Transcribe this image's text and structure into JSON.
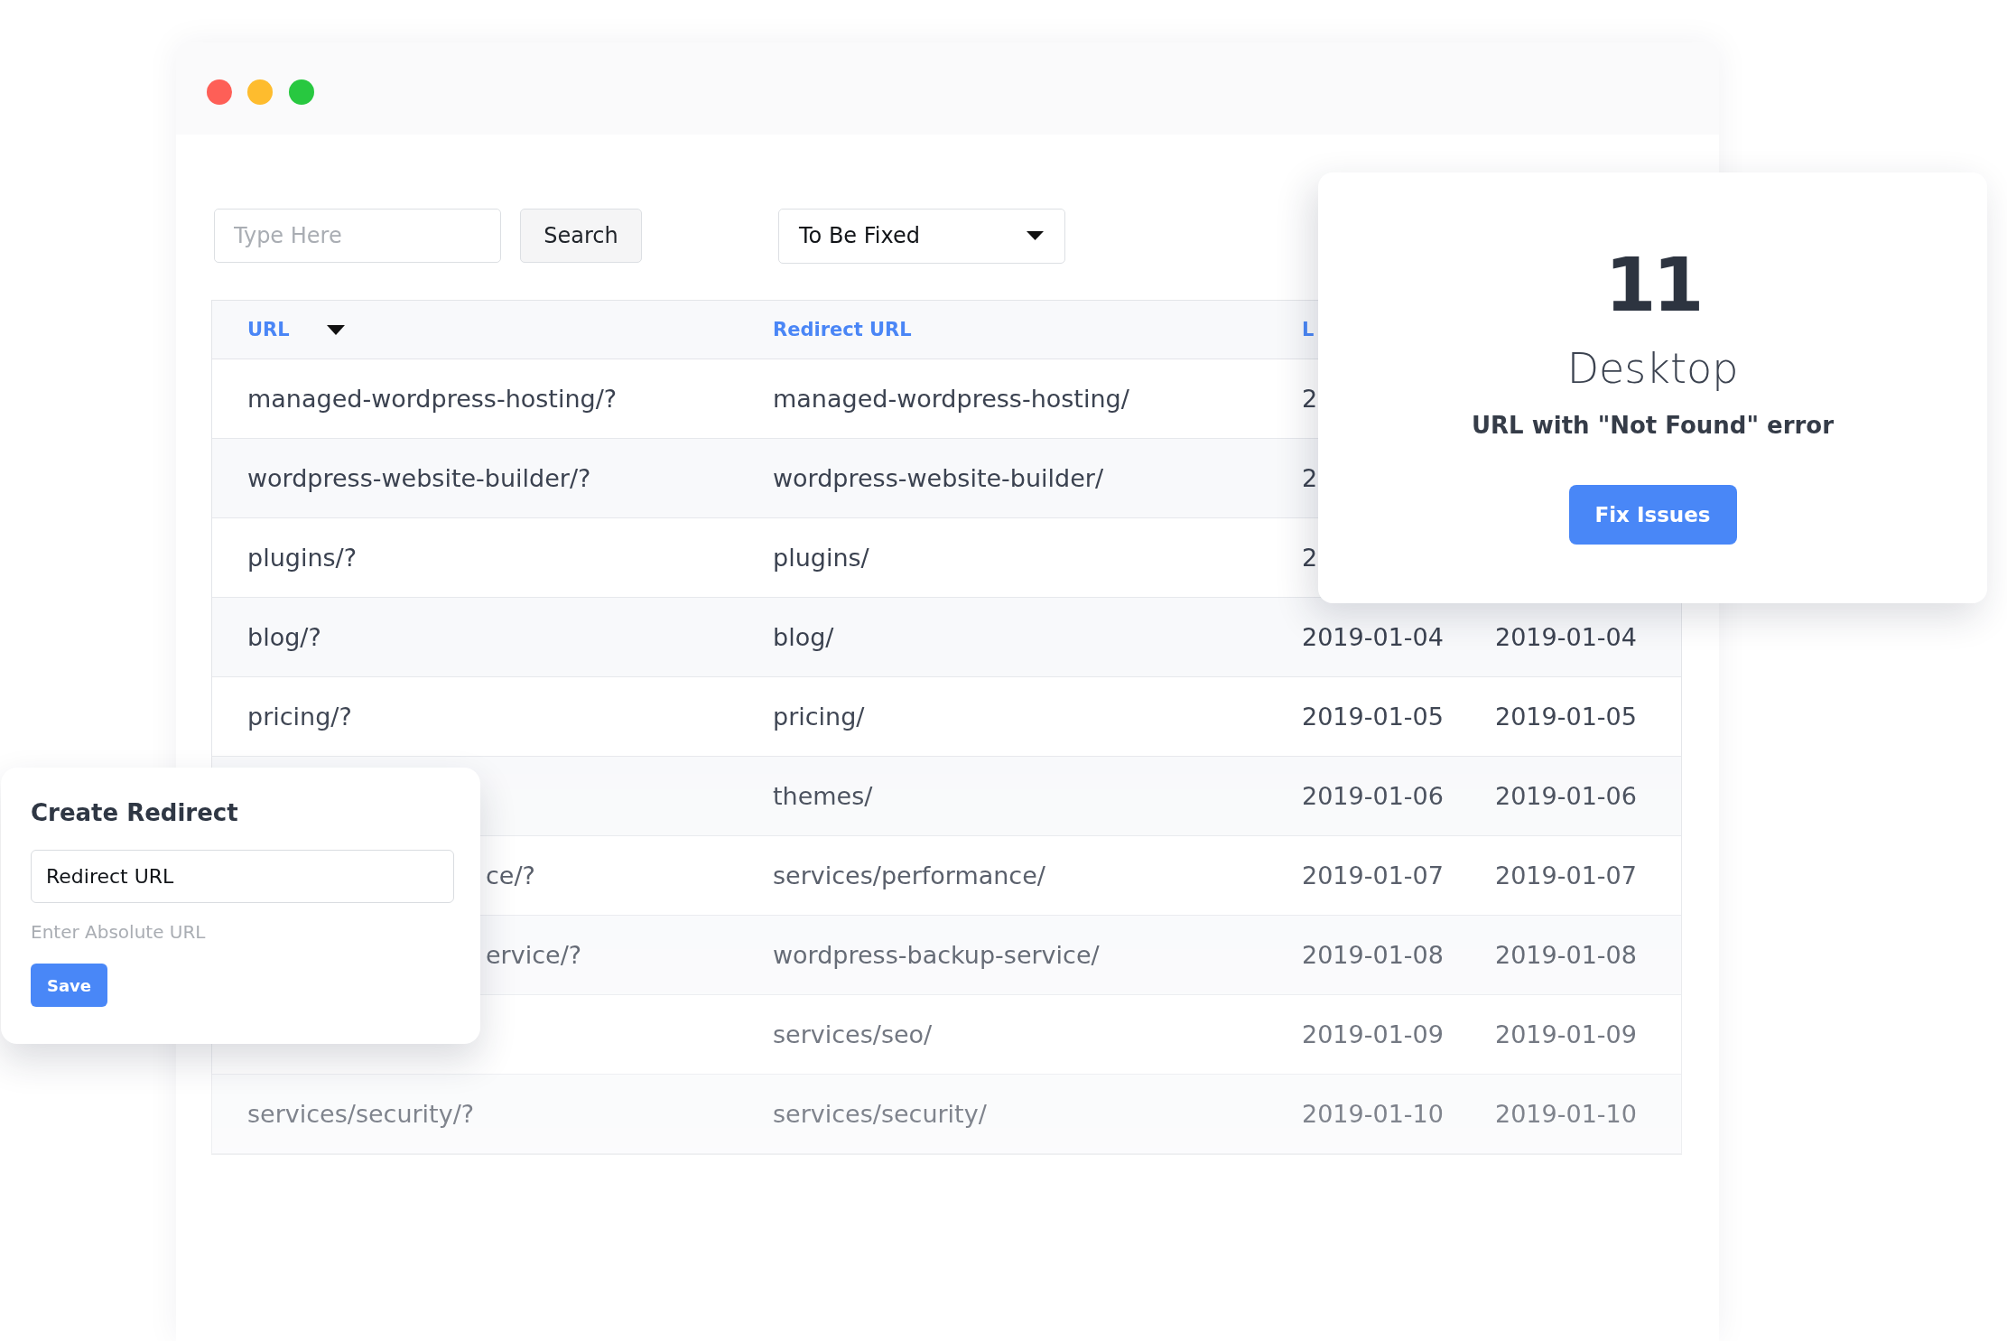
{
  "window": {
    "controls": [
      {
        "color": "#fe5f57"
      },
      {
        "color": "#febc2e"
      },
      {
        "color": "#28c840"
      }
    ]
  },
  "toolbar": {
    "search": {
      "placeholder": "Type Here"
    },
    "search_button": "Search",
    "filter": {
      "value": "To Be Fixed"
    }
  },
  "table": {
    "columns": [
      {
        "label": "URL",
        "sorted": true
      },
      {
        "label": "Redirect URL",
        "sorted": false
      },
      {
        "label": "L",
        "sorted": false
      }
    ],
    "rows": [
      {
        "url": "managed-wordpress-hosting/?",
        "redirect_url": "managed-wordpress-hosting/",
        "column_3": "2"
      },
      {
        "url": "wordpress-website-builder/?",
        "redirect_url": "wordpress-website-builder/",
        "column_3": "2"
      },
      {
        "url": "plugins/?",
        "redirect_url": "plugins/",
        "column_3": "2"
      },
      {
        "url": "blog/?",
        "redirect_url": "blog/",
        "column_3": "2019-01-04",
        "column_4": "2019-01-04"
      },
      {
        "url": "pricing/?",
        "redirect_url": "pricing/",
        "column_3": "2019-01-05",
        "column_4": "2019-01-05"
      },
      {
        "redirect_url": "themes/",
        "column_3": "2019-01-06",
        "column_4": "2019-01-06"
      },
      {
        "url": "ce/?",
        "redirect_url": "services/performance/",
        "column_3": "2019-01-07",
        "column_4": "2019-01-07"
      },
      {
        "url": "ervice/?",
        "redirect_url": "wordpress-backup-service/",
        "column_3": "2019-01-08",
        "column_4": "2019-01-08"
      },
      {
        "redirect_url": "services/seo/",
        "column_3": "2019-01-09",
        "column_4": "2019-01-09"
      },
      {
        "url": "services/security/?",
        "redirect_url": "services/security/",
        "column_3": "2019-01-10",
        "column_4": "2019-01-10"
      }
    ]
  },
  "summary_card": {
    "count": "11",
    "title": "Desktop",
    "subtitle": "URL with \"Not Found\" error",
    "button": "Fix Issues"
  },
  "redirect_form": {
    "title": "Create Redirect",
    "field": {
      "value": "Redirect URL"
    },
    "hint": "Enter Absolute URL",
    "button": "Save"
  }
}
